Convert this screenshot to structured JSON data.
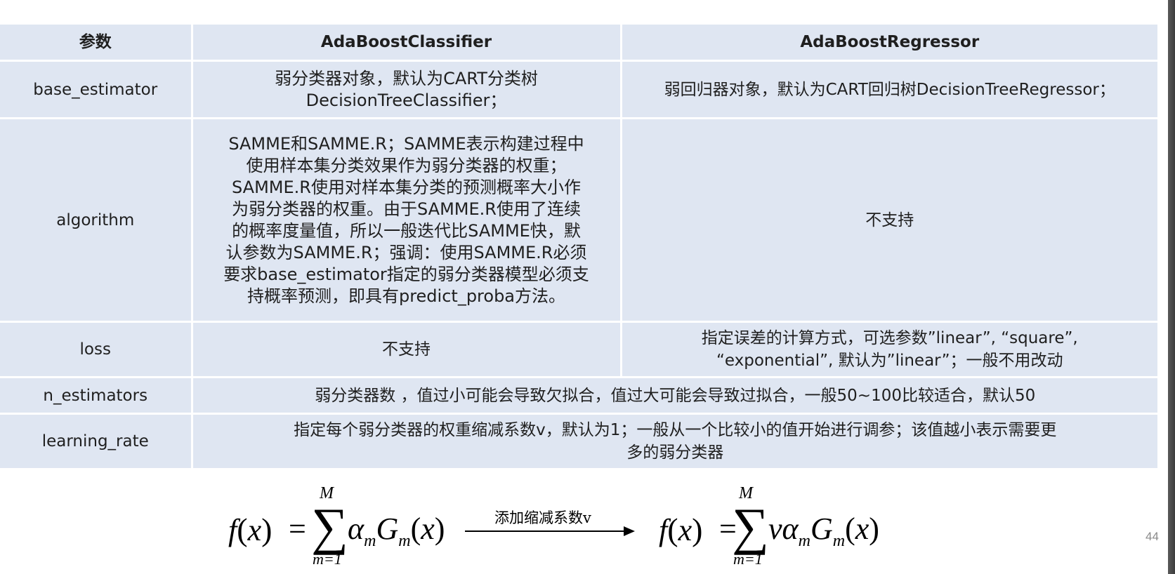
{
  "table": {
    "headers": [
      "参数",
      "AdaBoostClassifier",
      "AdaBoostRegressor"
    ],
    "rows": [
      {
        "param": "base_estimator",
        "classifier_lines": [
          "弱分类器对象，默认为CART分类树",
          "DecisionTreeClassifier；"
        ],
        "regressor": "弱回归器对象，默认为CART回归树DecisionTreeRegressor；"
      },
      {
        "param": "algorithm",
        "classifier_lines": [
          "SAMME和SAMME.R；SAMME表示构建过程中",
          "使用样本集分类效果作为弱分类器的权重；",
          "SAMME.R使用对样本集分类的预测概率大小作",
          "为弱分类器的权重。由于SAMME.R使用了连续",
          "的概率度量值，所以一般迭代比SAMME快，默",
          "认参数为SAMME.R；强调：使用SAMME.R必须",
          "要求base_estimator指定的弱分类器模型必须支",
          "持概率预测，即具有predict_proba方法。"
        ],
        "regressor": "不支持"
      },
      {
        "param": "loss",
        "classifier": "不支持",
        "regressor_lines": [
          "指定误差的计算方式，可选参数”linear”, “square”,",
          "“exponential”, 默认为”linear”；一般不用改动"
        ]
      },
      {
        "param": "n_estimators",
        "merged": "弱分类器数 ，值过小可能会导致欠拟合，值过大可能会导致过拟合，一般50~100比较适合，默认50"
      },
      {
        "param": "learning_rate",
        "merged_lines": [
          "指定每个弱分类器的权重缩减系数v，默认为1；一般从一个比较小的值开始进行调参；该值越小表示需要更",
          "多的弱分类器"
        ]
      }
    ]
  },
  "formula": {
    "left": {
      "fx": "f",
      "var": "x",
      "eq": "=",
      "sigma": "∑",
      "upper": "M",
      "lower": "m=1",
      "alpha": "α",
      "G": "G",
      "sub": "m"
    },
    "arrow_label": "添加缩减系数v",
    "right": {
      "fx": "f",
      "var": "x",
      "eq": "=",
      "sigma": "∑",
      "upper": "M",
      "lower": "m=1",
      "v": "v",
      "alpha": "α",
      "G": "G",
      "sub": "m"
    }
  },
  "page_number": "44"
}
